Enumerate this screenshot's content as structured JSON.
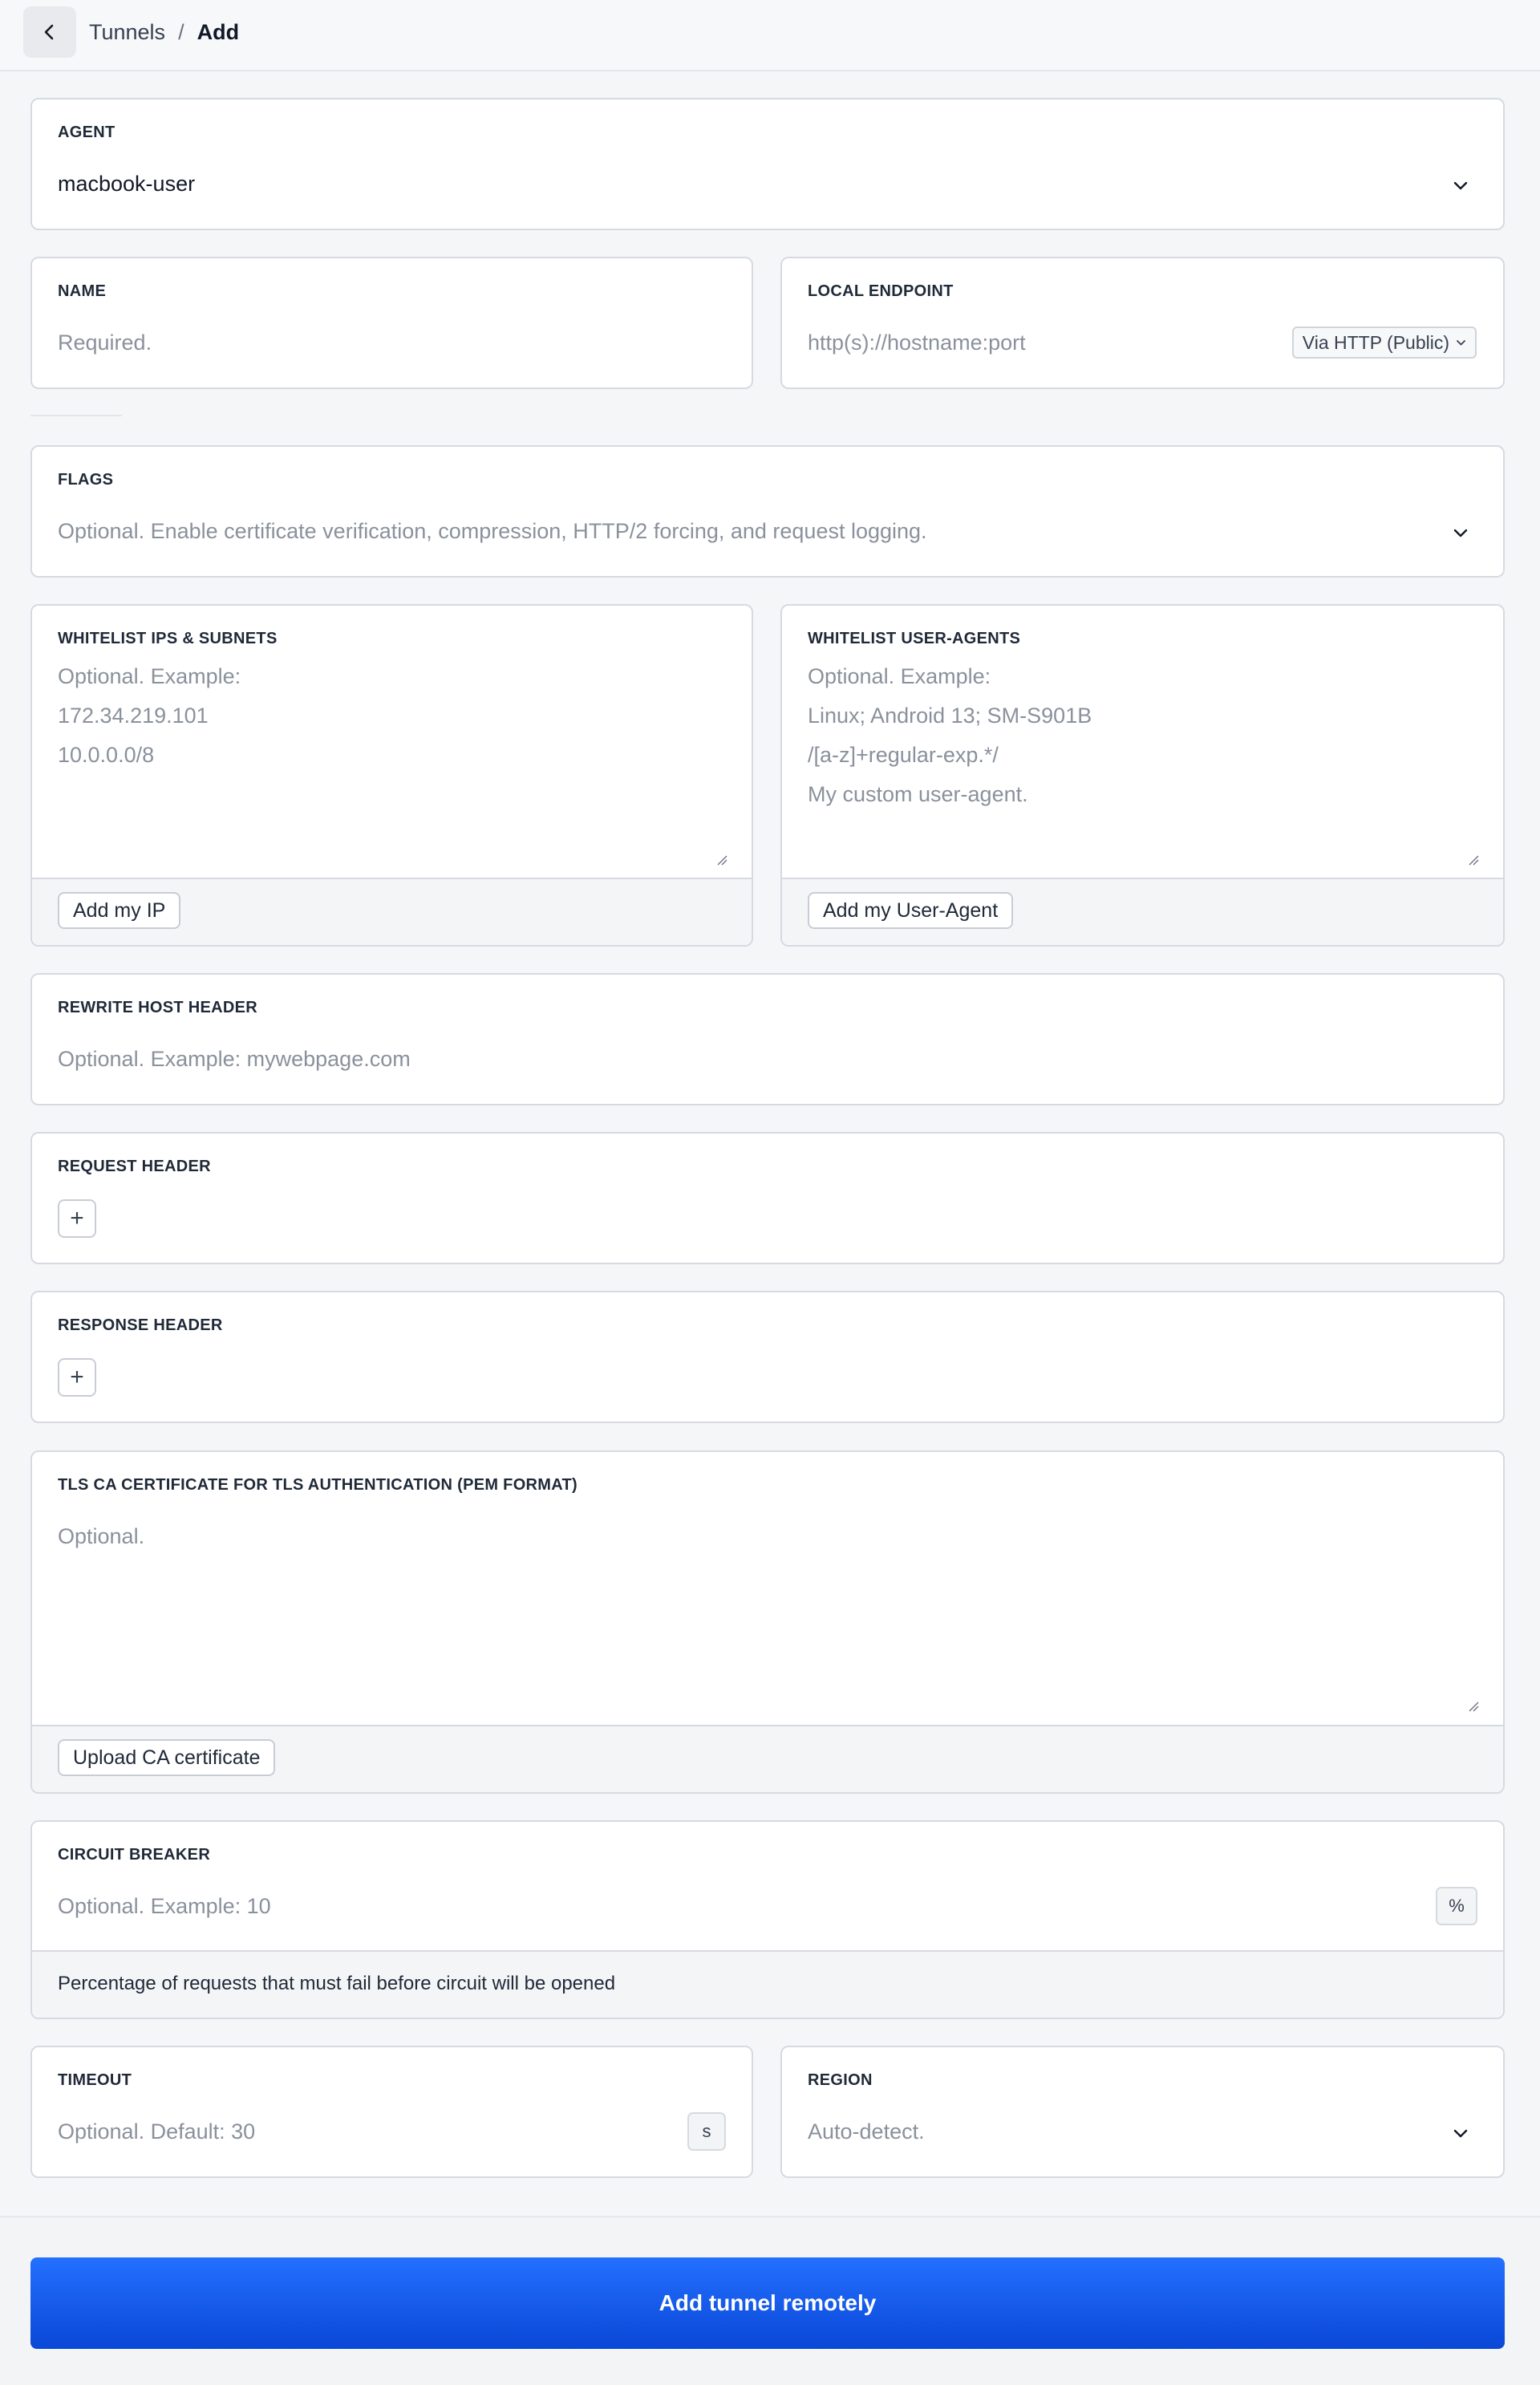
{
  "header": {
    "breadcrumb_parent": "Tunnels",
    "breadcrumb_separator": "/",
    "breadcrumb_current": "Add"
  },
  "agent": {
    "label": "AGENT",
    "value": "macbook-user"
  },
  "name": {
    "label": "NAME",
    "placeholder": "Required."
  },
  "local_endpoint": {
    "label": "LOCAL ENDPOINT",
    "placeholder": "http(s)://hostname:port",
    "mode": "Via HTTP (Public)"
  },
  "flags": {
    "label": "FLAGS",
    "placeholder": "Optional. Enable certificate verification, compression, HTTP/2 forcing, and request logging."
  },
  "whitelist_ips": {
    "label": "WHITELIST IPS & SUBNETS",
    "placeholder": "Optional. Example:\n172.34.219.101\n10.0.0.0/8",
    "button": "Add my IP"
  },
  "whitelist_user_agents": {
    "label": "WHITELIST USER-AGENTS",
    "placeholder": "Optional. Example:\nLinux; Android 13; SM-S901B\n/[a-z]+regular-exp.*/\nMy custom user-agent.",
    "button": "Add my User-Agent"
  },
  "rewrite_host_header": {
    "label": "REWRITE HOST HEADER",
    "placeholder": "Optional. Example: mywebpage.com"
  },
  "request_header": {
    "label": "REQUEST HEADER",
    "add_symbol": "+"
  },
  "response_header": {
    "label": "RESPONSE HEADER",
    "add_symbol": "+"
  },
  "tls_ca": {
    "label": "TLS CA CERTIFICATE FOR TLS AUTHENTICATION (PEM FORMAT)",
    "placeholder": "Optional.",
    "button": "Upload CA certificate"
  },
  "circuit_breaker": {
    "label": "CIRCUIT BREAKER",
    "placeholder": "Optional. Example: 10",
    "unit": "%",
    "helper": "Percentage of requests that must fail before circuit will be opened"
  },
  "timeout": {
    "label": "TIMEOUT",
    "placeholder": "Optional. Default: 30",
    "unit": "s"
  },
  "region": {
    "label": "REGION",
    "placeholder": "Auto-detect."
  },
  "submit": {
    "label": "Add tunnel remotely"
  },
  "icons": {
    "back": "chevron-left-icon",
    "dropdown": "chevron-down-icon",
    "resize": "resize-handle-icon"
  },
  "colors": {
    "primary": "#0a56f0",
    "border": "#d6dae0",
    "placeholder": "#8a919c"
  }
}
